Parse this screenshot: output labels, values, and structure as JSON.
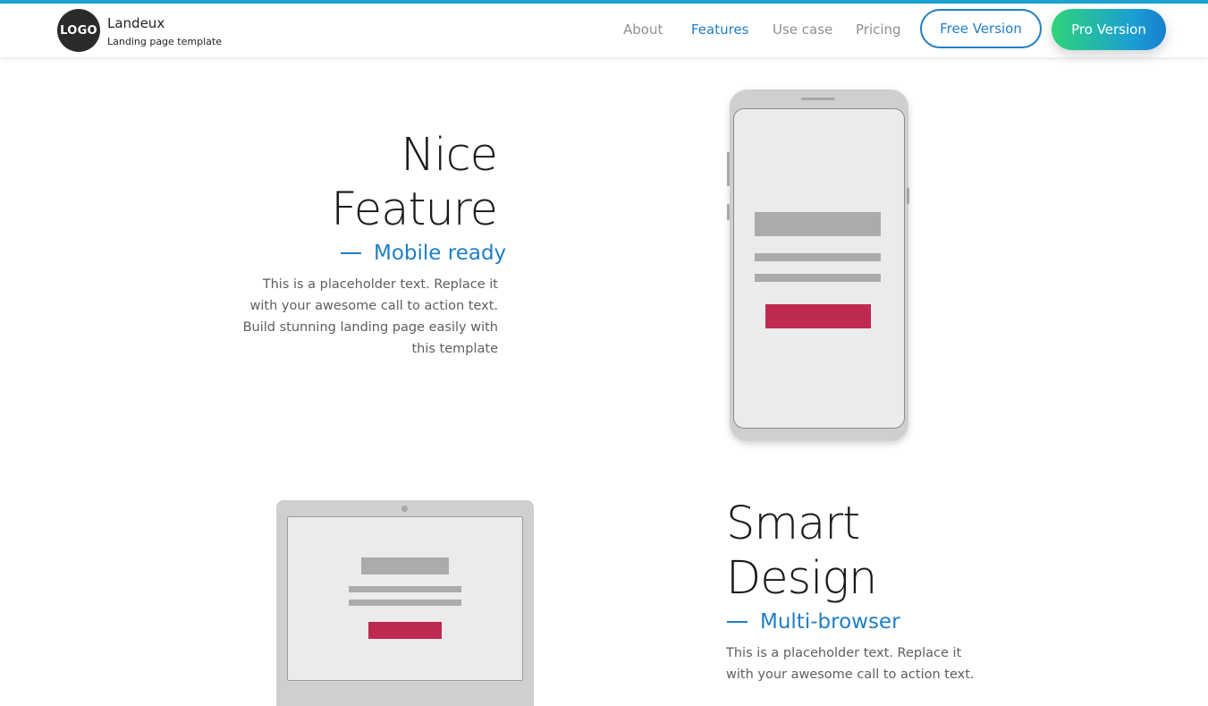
{
  "header": {
    "logo_text": "LOGO",
    "brand_name": "Landeux",
    "brand_tagline": "Landing page template",
    "nav": [
      {
        "label": "About",
        "active": false
      },
      {
        "label": "Features",
        "active": true
      },
      {
        "label": "Use case",
        "active": false
      },
      {
        "label": "Pricing",
        "active": false
      }
    ],
    "free_button": "Free Version",
    "pro_button": "Pro Version"
  },
  "features": [
    {
      "title_line1": "Nice",
      "title_line2": "Feature",
      "subtitle": "Mobile ready",
      "description_lines": [
        "This is a placeholder text. Replace it",
        "with your awesome call to action text.",
        "Build stunning landing page easily with",
        "this template"
      ],
      "device": "phone"
    },
    {
      "title_line1": "Smart",
      "title_line2": "Design",
      "subtitle": "Multi-browser",
      "description_lines": [
        "This is a placeholder text. Replace it",
        "with your awesome call to action text."
      ],
      "device": "laptop"
    }
  ],
  "colors": {
    "accent": "#1f7ec6",
    "cta": "#bf2a51",
    "top_line": "#1aa6d6"
  }
}
